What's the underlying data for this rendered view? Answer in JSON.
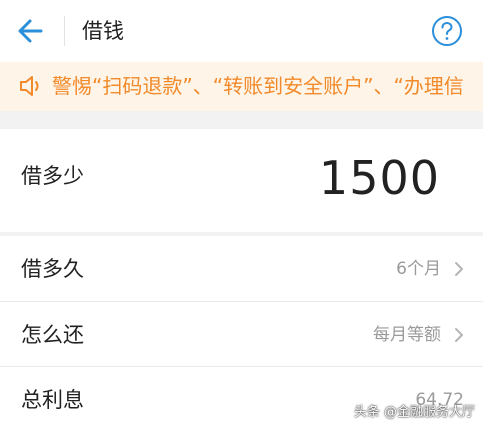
{
  "colors": {
    "accent": "#2b8fd9",
    "notice_text": "#f28a2a",
    "notice_bg": "#fef4e8",
    "background": "#f2f2f2"
  },
  "header": {
    "title": "借钱",
    "back_icon": "arrow-left-icon",
    "help_icon": "question-circle-icon"
  },
  "notice": {
    "icon": "speaker-icon",
    "text": "警惕“扫码退款”、“转账到安全账户”、“办理信"
  },
  "amount": {
    "label": "借多少",
    "value": "1500"
  },
  "term": {
    "label": "借多久",
    "value": "6个月"
  },
  "repay": {
    "label": "怎么还",
    "value": "每月等额"
  },
  "interest": {
    "label": "总利息",
    "value": "64.72"
  },
  "watermark": {
    "text": "头条 @金融服务大厅"
  }
}
